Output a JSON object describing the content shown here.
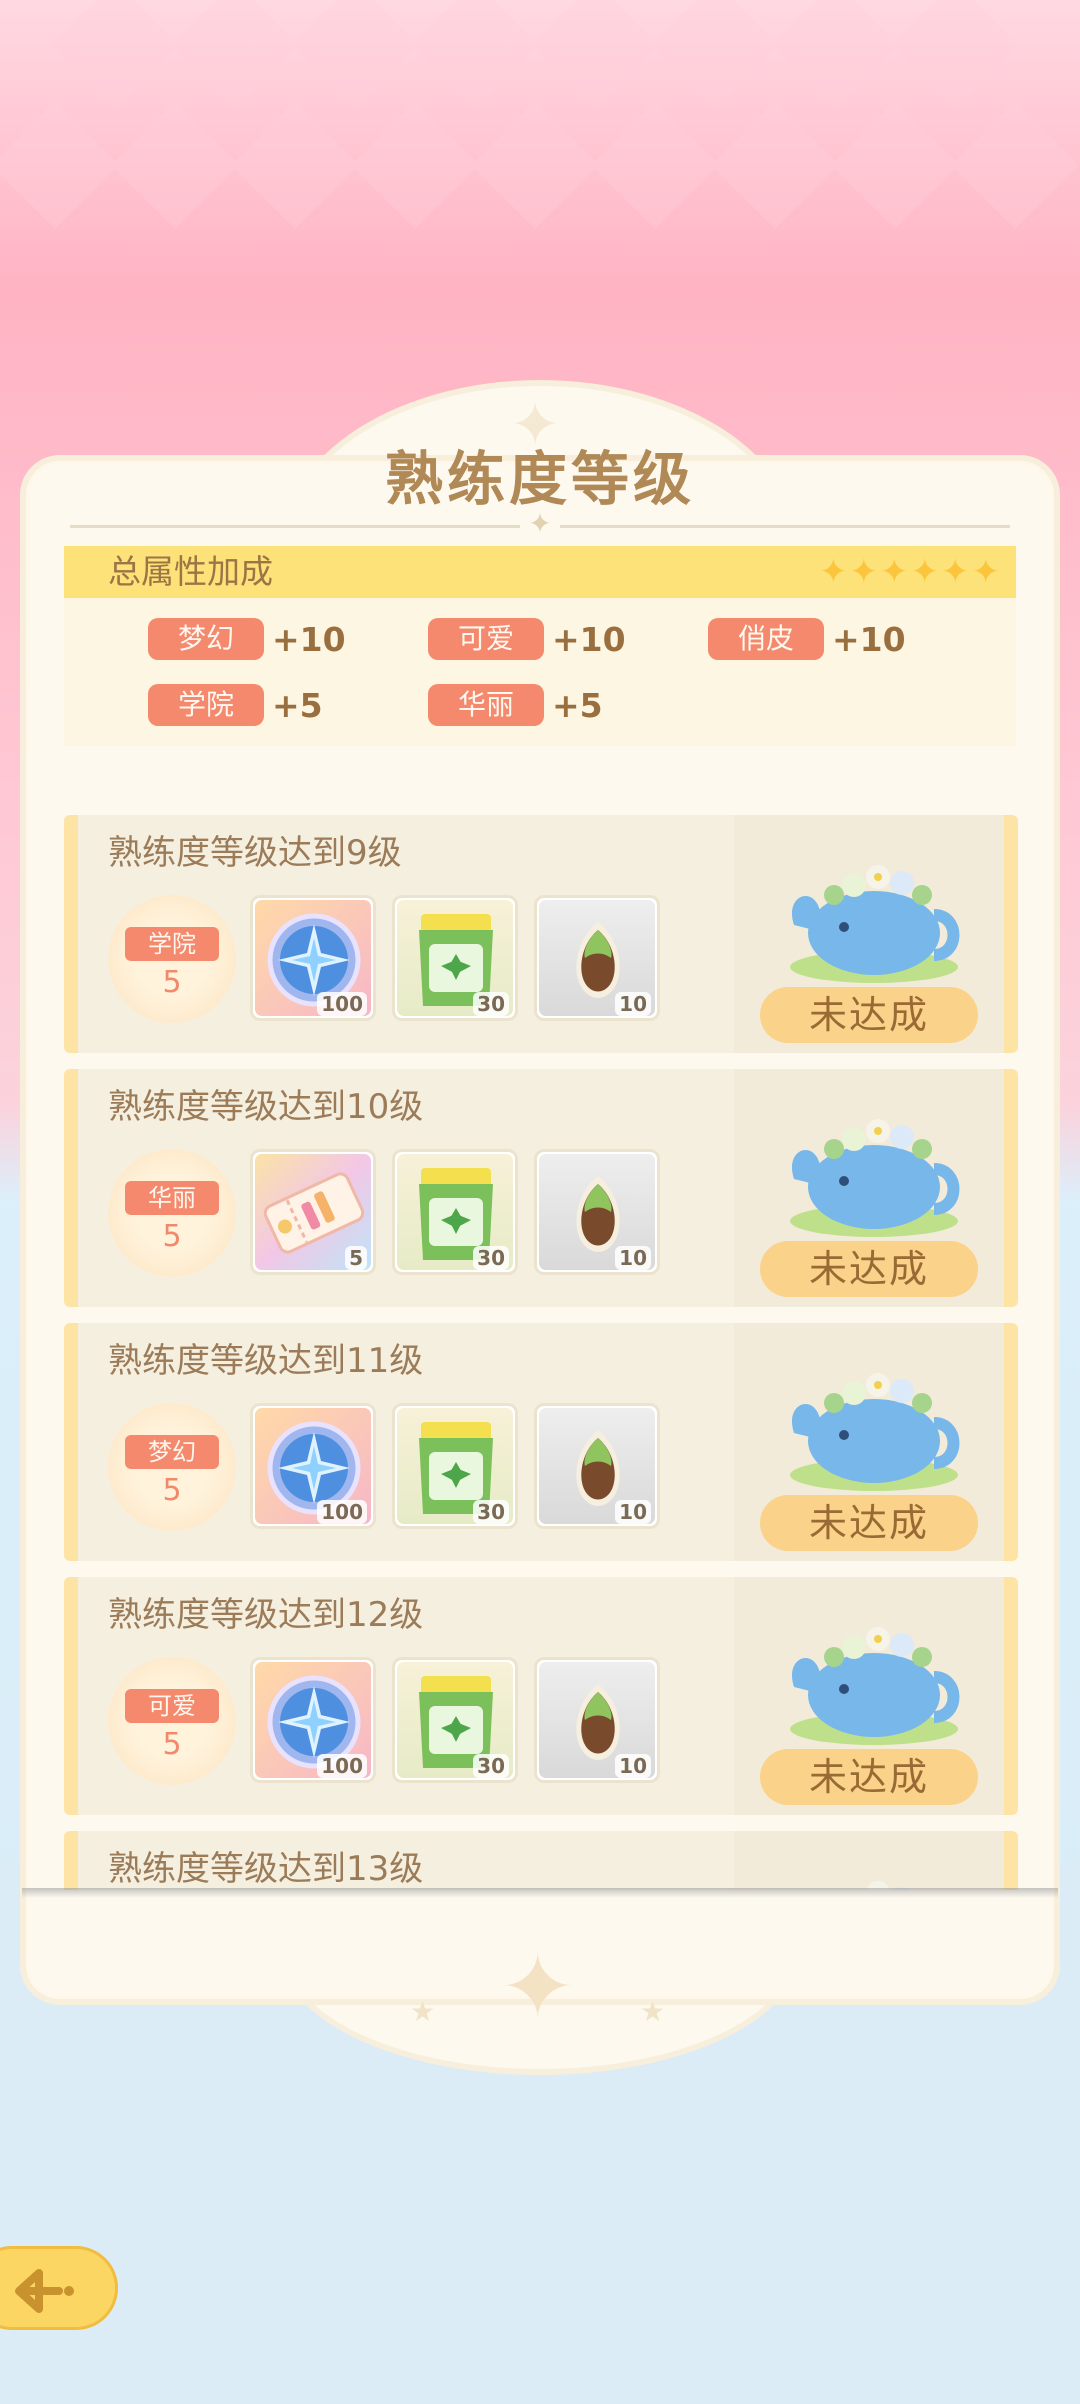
{
  "title": "熟练度等级",
  "bonus": {
    "header": "总属性加成",
    "stars": "✦✦✦✦✦✦",
    "attributes": [
      {
        "name": "梦幻",
        "value": "+10"
      },
      {
        "name": "可爱",
        "value": "+10"
      },
      {
        "name": "俏皮",
        "value": "+10"
      },
      {
        "name": "学院",
        "value": "+5"
      },
      {
        "name": "华丽",
        "value": "+5"
      }
    ]
  },
  "rewards": [
    {
      "title": "熟练度等级达到9级",
      "attr_name": "学院",
      "attr_value": "5",
      "items": [
        {
          "icon": "compass-medal-icon",
          "count": "100"
        },
        {
          "icon": "fertilizer-bag-icon",
          "count": "30"
        },
        {
          "icon": "seed-icon",
          "count": "10"
        }
      ],
      "status": "未达成"
    },
    {
      "title": "熟练度等级达到10级",
      "attr_name": "华丽",
      "attr_value": "5",
      "items": [
        {
          "icon": "ticket-icon",
          "count": "5"
        },
        {
          "icon": "fertilizer-bag-icon",
          "count": "30"
        },
        {
          "icon": "seed-icon",
          "count": "10"
        }
      ],
      "status": "未达成"
    },
    {
      "title": "熟练度等级达到11级",
      "attr_name": "梦幻",
      "attr_value": "5",
      "items": [
        {
          "icon": "compass-medal-icon",
          "count": "100"
        },
        {
          "icon": "fertilizer-bag-icon",
          "count": "30"
        },
        {
          "icon": "seed-icon",
          "count": "10"
        }
      ],
      "status": "未达成"
    },
    {
      "title": "熟练度等级达到12级",
      "attr_name": "可爱",
      "attr_value": "5",
      "items": [
        {
          "icon": "compass-medal-icon",
          "count": "100"
        },
        {
          "icon": "fertilizer-bag-icon",
          "count": "30"
        },
        {
          "icon": "seed-icon",
          "count": "10"
        }
      ],
      "status": "未达成"
    },
    {
      "title": "熟练度等级达到13级"
    }
  ],
  "icons": {
    "back": "back-arrow-icon",
    "mascot": "elephant-watering-can-icon"
  },
  "colors": {
    "accent_tag": "#f4896d",
    "title": "#b08956",
    "status_button": "#fbd28a",
    "bonus_header": "#fde27a"
  }
}
